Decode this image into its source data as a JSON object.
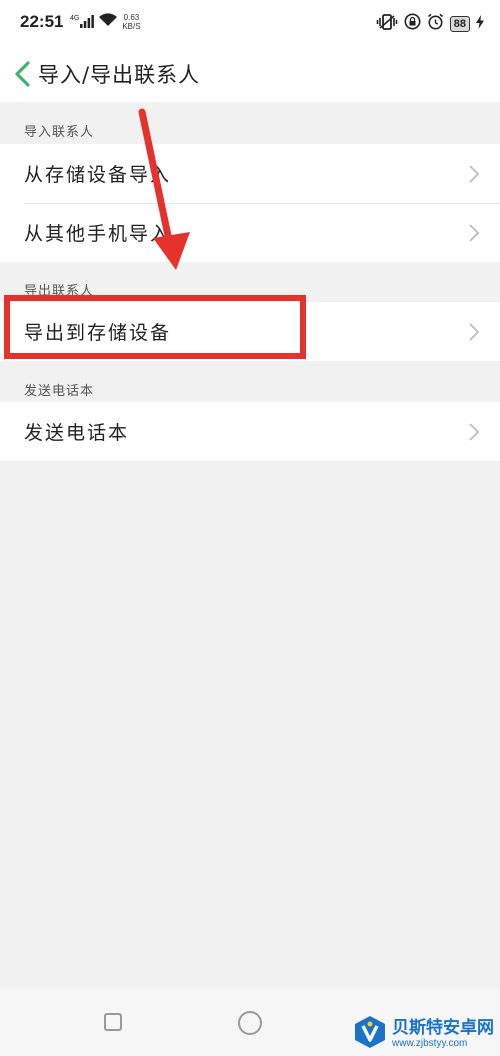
{
  "status_bar": {
    "time": "22:51",
    "network_type": "4G",
    "net_speed_value": "0.63",
    "net_speed_unit": "KB/S",
    "battery_level": "88"
  },
  "header": {
    "title": "导入/导出联系人"
  },
  "sections": {
    "import": {
      "title": "导入联系人",
      "items": [
        {
          "label": "从存储设备导入"
        },
        {
          "label": "从其他手机导入"
        }
      ]
    },
    "export": {
      "title": "导出联系人",
      "items": [
        {
          "label": "导出到存储设备"
        }
      ]
    },
    "send": {
      "title": "发送电话本",
      "items": [
        {
          "label": "发送电话本"
        }
      ]
    }
  },
  "watermark": {
    "name": "贝斯特安卓网",
    "url": "www.zjbstyy.com"
  },
  "colors": {
    "accent": "#3cb371",
    "annotation": "#e5322d",
    "watermark": "#1a73c9"
  }
}
